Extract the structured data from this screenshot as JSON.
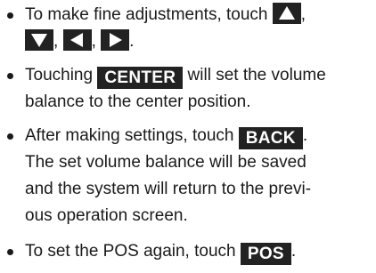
{
  "items": [
    {
      "text_before": "To make fine adjustments, touch",
      "keys": {
        "up_icon": "up-triangle",
        "down_icon": "down-triangle",
        "left_icon": "left-triangle",
        "right_icon": "right-triangle"
      },
      "comma": ",",
      "period": "."
    },
    {
      "text_before": "Touching",
      "key_label": "CENTER",
      "text_after": "will set the volume balance to the center position."
    },
    {
      "text_before": "After making settings, touch",
      "key_label": "BACK",
      "period": ".",
      "text_after": "The set volume balance will be saved and the system will return to the previous operation screen.",
      "text_after_line1": "The set volume balance will be saved",
      "text_after_line2": "and the system will return to the previ-",
      "text_after_line3": "ous operation screen."
    },
    {
      "text_before": "To set the POS again, touch",
      "key_label": "POS",
      "period": "."
    }
  ],
  "colors": {
    "key_bg": "#222222",
    "key_text": "#ffffff",
    "body_text": "#1a1a1a"
  }
}
